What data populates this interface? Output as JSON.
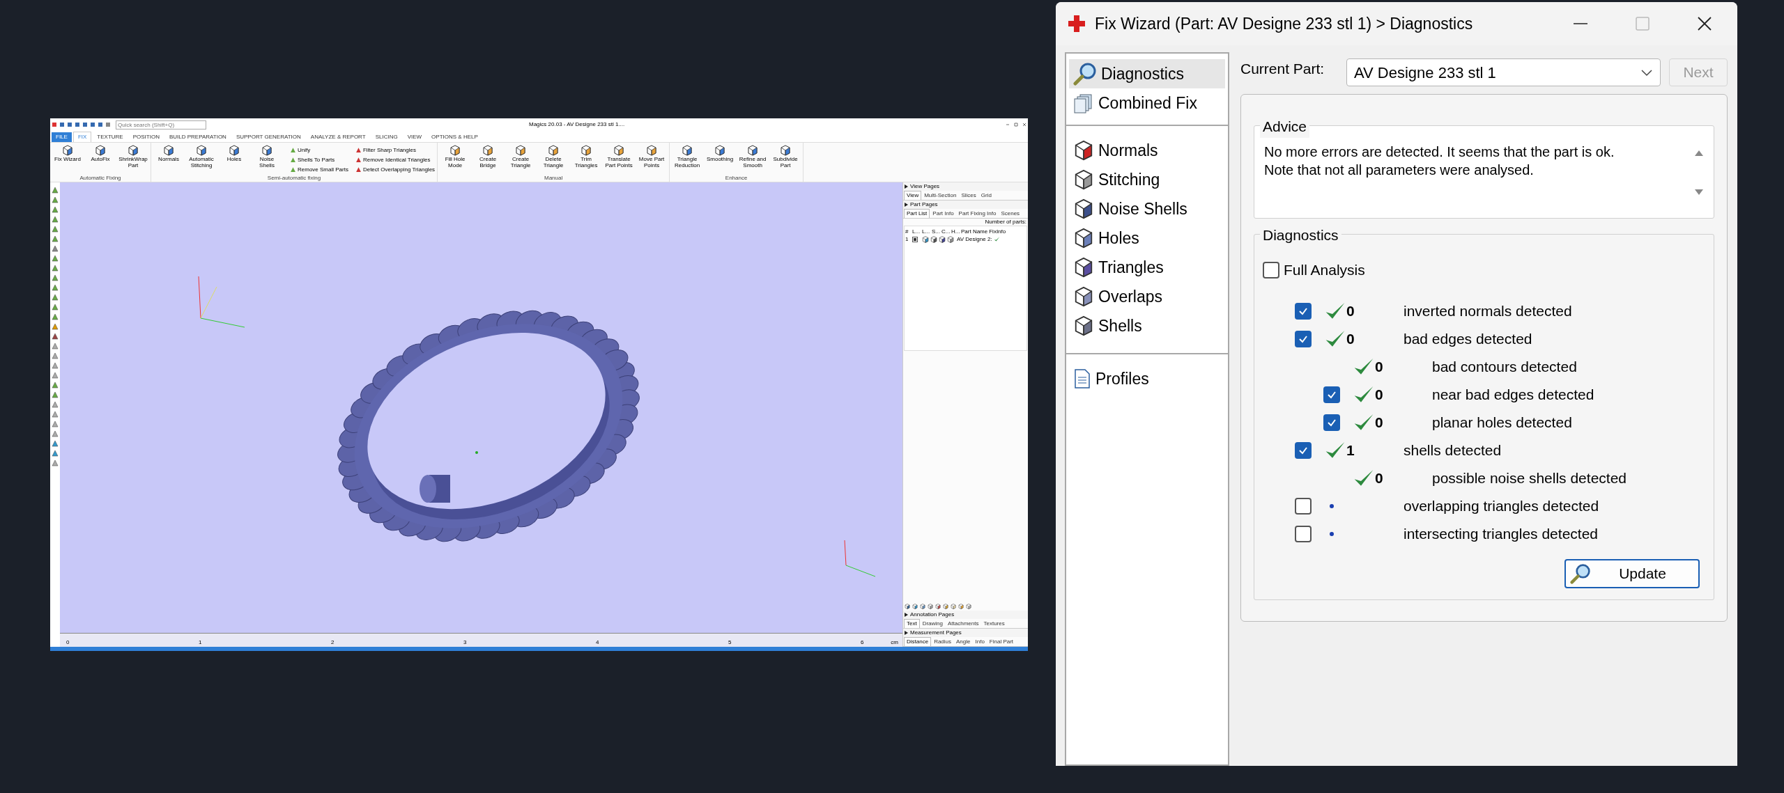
{
  "magics": {
    "title": "Magics 20.03 - AV Designe 233 stl 1....",
    "search": {
      "placeholder": "Quick search (Shift+Q)"
    },
    "tabs": [
      {
        "label": "FILE",
        "kind": "menu",
        "selected": false
      },
      {
        "label": "FIX",
        "kind": "tab",
        "selected": true
      },
      {
        "label": "TEXTURE",
        "kind": "tab",
        "selected": false
      },
      {
        "label": "POSITION",
        "kind": "tab",
        "selected": false
      },
      {
        "label": "BUILD PREPARATION",
        "kind": "tab",
        "selected": false
      },
      {
        "label": "SUPPORT GENERATION",
        "kind": "tab",
        "selected": false
      },
      {
        "label": "ANALYZE & REPORT",
        "kind": "tab",
        "selected": false
      },
      {
        "label": "SLICING",
        "kind": "tab",
        "selected": false
      },
      {
        "label": "VIEW",
        "kind": "tab",
        "selected": false
      },
      {
        "label": "OPTIONS & HELP",
        "kind": "tab",
        "selected": false
      }
    ],
    "ribbon_groups": [
      {
        "label": "Automatic Fixing",
        "buttons": [
          "Fix Wizard",
          "AutoFix",
          "ShrinkWrap Part"
        ]
      },
      {
        "label": "Semi-automatic fixing",
        "buttons": [
          "Normals",
          "Automatic Stitching",
          "Holes",
          "Noise Shells"
        ],
        "small_buttons": [
          "Unify",
          "Shells To Parts",
          "Remove Small Parts",
          "Filter Sharp Triangles",
          "Remove Identical Triangles",
          "Detect Overlapping Triangles"
        ]
      },
      {
        "label": "Manual",
        "buttons": [
          "Fill Hole Mode",
          "Create Bridge",
          "Create Triangle",
          "Delete Triangle",
          "Trim Triangles",
          "Translate Part Points",
          "Move Part Points"
        ]
      },
      {
        "label": "Enhance",
        "buttons": [
          "Triangle Reduction",
          "Smoothing",
          "Refine and Smooth",
          "Subdivide Part"
        ]
      }
    ],
    "ruler": {
      "ticks": [
        "0",
        "1",
        "2",
        "3",
        "4",
        "5",
        "6"
      ],
      "unit": "cm"
    },
    "side_panel": {
      "view_pages": {
        "title": "View Pages",
        "tabs": [
          {
            "label": "View",
            "selected": true
          },
          {
            "label": "Multi-Section",
            "selected": false
          },
          {
            "label": "Slices",
            "selected": false
          },
          {
            "label": "Grid",
            "selected": false
          }
        ]
      },
      "part_pages": {
        "title": "Part Pages",
        "tabs": [
          {
            "label": "Part List",
            "selected": true
          },
          {
            "label": "Part Info",
            "selected": false
          },
          {
            "label": "Part Fixing Info",
            "selected": false
          },
          {
            "label": "Scenes",
            "selected": false
          }
        ],
        "count_label": "Number of parts:",
        "columns": [
          "#",
          "L...",
          "L...",
          "S...",
          "C...",
          "H...",
          "Part Name",
          "FixInfo"
        ],
        "rows": [
          {
            "number": "1",
            "visible": true,
            "name": "AV Designe 2:",
            "fixed": true
          }
        ]
      },
      "annotation_pages": {
        "title": "Annotation Pages",
        "tabs": [
          {
            "label": "Text",
            "selected": true
          },
          {
            "label": "Drawing",
            "selected": false
          },
          {
            "label": "Attachments",
            "selected": false
          },
          {
            "label": "Textures",
            "selected": false
          }
        ]
      },
      "measurement_pages": {
        "title": "Measurement Pages",
        "tabs": [
          {
            "label": "Distance",
            "selected": true
          },
          {
            "label": "Radius",
            "selected": false
          },
          {
            "label": "Angle",
            "selected": false
          },
          {
            "label": "Info",
            "selected": false
          },
          {
            "label": "Final Part",
            "selected": false
          }
        ]
      }
    }
  },
  "dialog": {
    "title": "Fix Wizard (Part: AV Designe 233 stl 1) > Diagnostics",
    "nav_groups": [
      {
        "items": [
          {
            "label": "Diagnostics",
            "selected": true
          },
          {
            "label": "Combined Fix",
            "selected": false
          }
        ]
      },
      {
        "items": [
          {
            "label": "Normals",
            "selected": false
          },
          {
            "label": "Stitching",
            "selected": false
          },
          {
            "label": "Noise Shells",
            "selected": false
          },
          {
            "label": "Holes",
            "selected": false
          },
          {
            "label": "Triangles",
            "selected": false
          },
          {
            "label": "Overlaps",
            "selected": false
          },
          {
            "label": "Shells",
            "selected": false
          }
        ]
      },
      {
        "items": [
          {
            "label": "Profiles",
            "selected": false
          }
        ]
      }
    ],
    "current_part": {
      "label": "Current Part:",
      "value": "AV Designe 233 stl 1"
    },
    "next_button": {
      "label": "Next",
      "disabled": true
    },
    "advice": {
      "title": "Advice",
      "text": "No more errors are detected. It seems that the part is ok.\nNote that not all parameters were analysed."
    },
    "diagnostics": {
      "title": "Diagnostics",
      "full_analysis": {
        "label": "Full Analysis",
        "checked": false
      },
      "checks": [
        {
          "kind": "checkbox",
          "checked": true,
          "ok": true,
          "count": "0",
          "label": "inverted normals detected"
        },
        {
          "kind": "checkbox",
          "checked": true,
          "ok": true,
          "count": "0",
          "label": "bad edges detected",
          "children": [
            {
              "kind": "plain",
              "ok": true,
              "count": "0",
              "label": "bad contours detected"
            },
            {
              "kind": "checkbox",
              "checked": true,
              "ok": true,
              "count": "0",
              "label": "near bad edges detected"
            },
            {
              "kind": "checkbox",
              "checked": true,
              "ok": true,
              "count": "0",
              "label": "planar holes detected"
            }
          ]
        },
        {
          "kind": "checkbox",
          "checked": true,
          "ok": true,
          "count": "1",
          "label": "shells detected",
          "children": [
            {
              "kind": "plain",
              "ok": true,
              "count": "0",
              "label": "possible noise shells detected"
            }
          ]
        },
        {
          "kind": "checkbox",
          "checked": false,
          "ok": false,
          "label": "overlapping triangles detected"
        },
        {
          "kind": "checkbox",
          "checked": false,
          "ok": false,
          "label": "intersecting triangles detected"
        }
      ],
      "update_button": "Update"
    }
  }
}
